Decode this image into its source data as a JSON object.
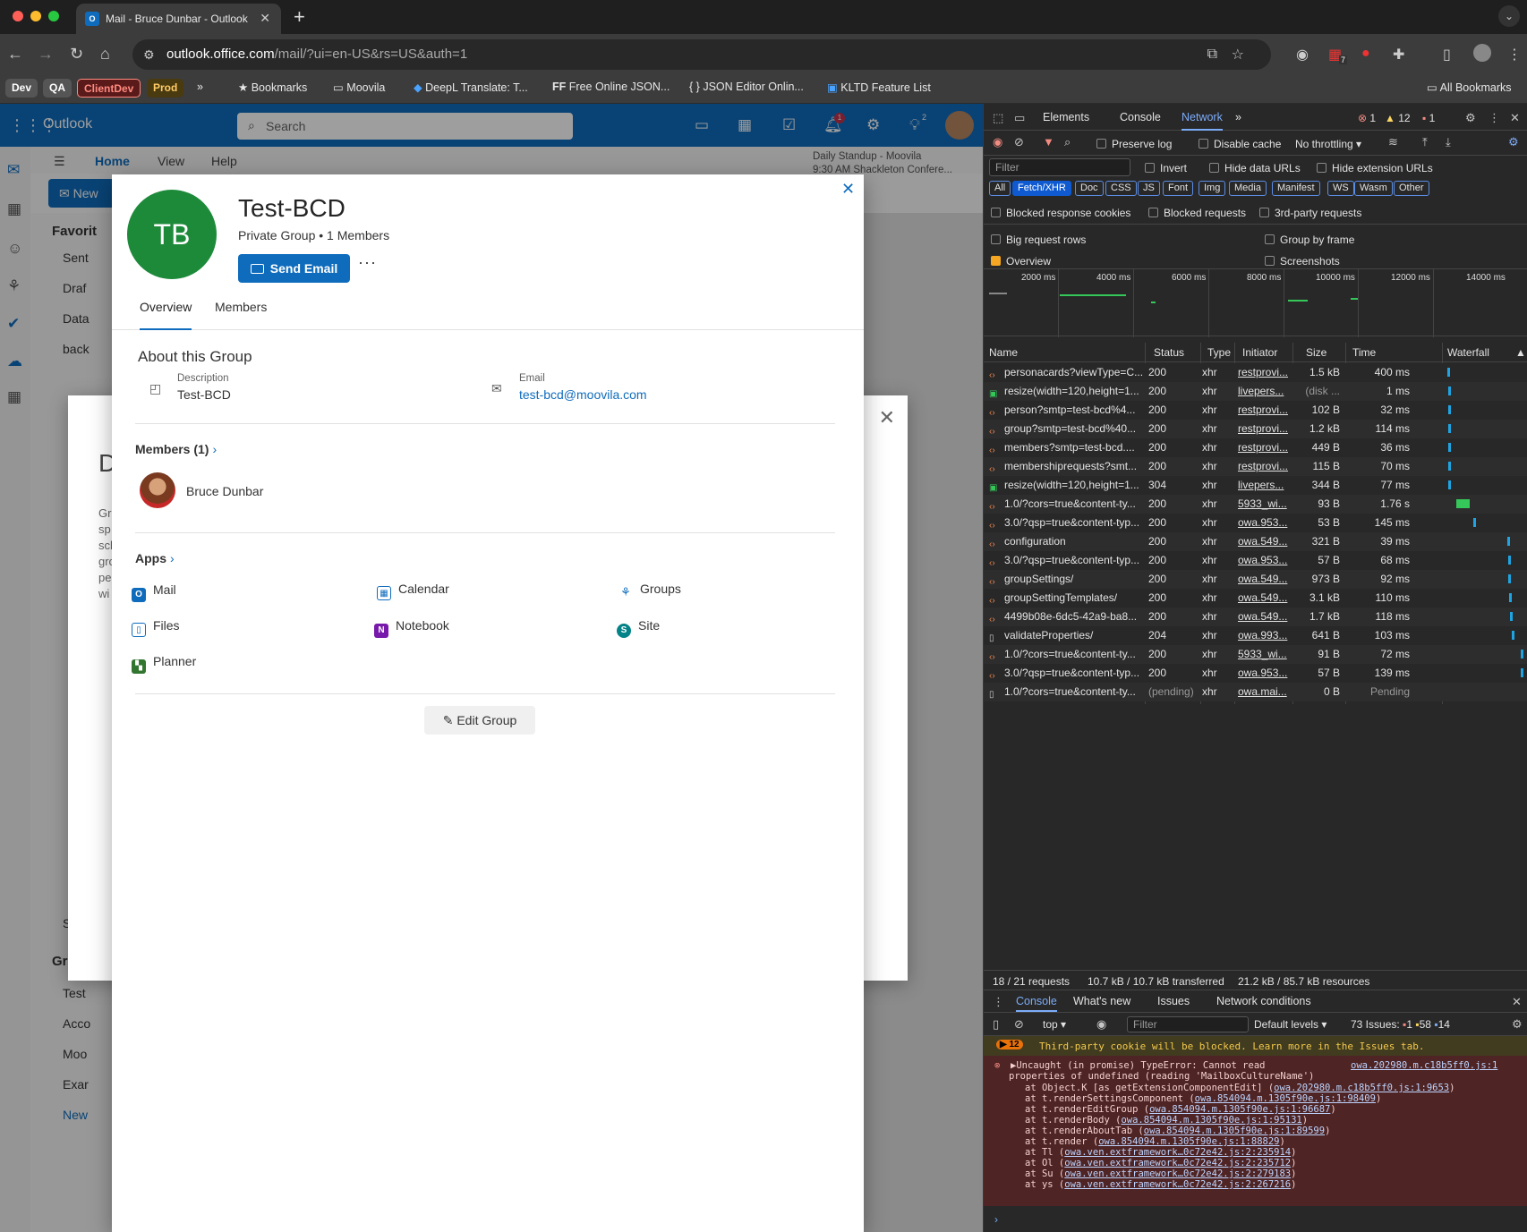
{
  "browser": {
    "tab_title": "Mail - Bruce Dunbar - Outlook",
    "tab_fav": "O",
    "url_host": "outlook.office.com",
    "url_path": "/mail/?ui=en-US&rs=US&auth=1",
    "bookmarks_chips": [
      "Dev",
      "QA",
      "ClientDev",
      "Prod"
    ],
    "bookmarks": [
      "Bookmarks",
      "Moovila",
      "DeepL Translate: T...",
      "Free Online JSON...",
      "JSON Editor Onlin...",
      "KLTD Feature List"
    ],
    "all_bookmarks": "All Bookmarks",
    "more_bookmarks": "»",
    "ext_badge": "7"
  },
  "outlook": {
    "app_name": "Outlook",
    "search_placeholder": "Search",
    "ribbon_tabs": [
      "Home",
      "View",
      "Help"
    ],
    "new_button": "New",
    "meeting_title": "Daily Standup - Moovila",
    "meeting_time": "9:30 AM Shackleton Confere...",
    "folders_header": "Favorit",
    "folders": [
      "Sent",
      "Draf",
      "Data",
      "back"
    ],
    "search_folder": "Sear",
    "groups_header": "Groups",
    "groups": [
      "Test",
      "Acco",
      "Moo",
      "Exar"
    ],
    "new_group": "New",
    "behind_letter": "D",
    "behind_text": [
      "Gr",
      "sp",
      "sch",
      "gro",
      "pe",
      "wi"
    ],
    "notif_badge": "1",
    "tips_badge": "2"
  },
  "card": {
    "initials": "TB",
    "name": "Test-BCD",
    "subtitle": "Private Group • 1 Members",
    "send_email": "Send Email",
    "more": "···",
    "close": "✕",
    "tabs": [
      "Overview",
      "Members"
    ],
    "about_title": "About this Group",
    "description_label": "Description",
    "description_value": "Test-BCD",
    "email_label": "Email",
    "email_value": "test-bcd@moovila.com",
    "members_header": "Members (1)",
    "member_name": "Bruce Dunbar",
    "apps_header": "Apps",
    "apps": [
      "Mail",
      "Calendar",
      "Groups",
      "Files",
      "Notebook",
      "Site",
      "Planner"
    ],
    "edit_group": "Edit Group",
    "colors": {
      "avatar": "#1d8a3a",
      "accent": "#0f6cbd"
    }
  },
  "devtools": {
    "tabs": [
      "Elements",
      "Console",
      "Network"
    ],
    "more_tabs": "»",
    "err_count": "1",
    "warn_count": "12",
    "issue_count": "1",
    "preserve_log": "Preserve log",
    "disable_cache": "Disable cache",
    "throttling": "No throttling",
    "filter_placeholder": "Filter",
    "invert": "Invert",
    "hide_data_urls": "Hide data URLs",
    "hide_ext_urls": "Hide extension URLs",
    "type_filters": [
      "All",
      "Fetch/XHR",
      "Doc",
      "CSS",
      "JS",
      "Font",
      "Img",
      "Media",
      "Manifest",
      "WS",
      "Wasm",
      "Other"
    ],
    "blocked_cookies": "Blocked response cookies",
    "blocked_requests": "Blocked requests",
    "third_party": "3rd-party requests",
    "big_rows": "Big request rows",
    "group_by_frame": "Group by frame",
    "overview": "Overview",
    "screenshots": "Screenshots",
    "overview_ticks": [
      "2000 ms",
      "4000 ms",
      "6000 ms",
      "8000 ms",
      "10000 ms",
      "12000 ms",
      "14000 ms"
    ],
    "columns": [
      "Name",
      "Status",
      "Type",
      "Initiator",
      "Size",
      "Time",
      "Waterfall"
    ],
    "rows": [
      {
        "name": "personacards?viewType=C...",
        "status": "200",
        "type": "xhr",
        "initiator": "restprovi...",
        "size": "1.5 kB",
        "time": "400 ms",
        "wf_start": 0.02,
        "wf_len": 0.04
      },
      {
        "name": "resize(width=120,height=1...",
        "status": "200",
        "type": "xhr",
        "initiator": "livepers...",
        "size": "(disk ...",
        "time": "1 ms",
        "wf_start": 0.03,
        "wf_len": 0.01
      },
      {
        "name": "person?smtp=test-bcd%4...",
        "status": "200",
        "type": "xhr",
        "initiator": "restprovi...",
        "size": "102 B",
        "time": "32 ms",
        "wf_start": 0.03,
        "wf_len": 0.01
      },
      {
        "name": "group?smtp=test-bcd%40...",
        "status": "200",
        "type": "xhr",
        "initiator": "restprovi...",
        "size": "1.2 kB",
        "time": "114 ms",
        "wf_start": 0.03,
        "wf_len": 0.01
      },
      {
        "name": "members?smtp=test-bcd....",
        "status": "200",
        "type": "xhr",
        "initiator": "restprovi...",
        "size": "449 B",
        "time": "36 ms",
        "wf_start": 0.03,
        "wf_len": 0.01
      },
      {
        "name": "membershiprequests?smt...",
        "status": "200",
        "type": "xhr",
        "initiator": "restprovi...",
        "size": "115 B",
        "time": "70 ms",
        "wf_start": 0.03,
        "wf_len": 0.01
      },
      {
        "name": "resize(width=120,height=1...",
        "status": "304",
        "type": "xhr",
        "initiator": "livepers...",
        "size": "344 B",
        "time": "77 ms",
        "wf_start": 0.03,
        "wf_len": 0.01
      },
      {
        "name": "1.0/?cors=true&content-ty...",
        "status": "200",
        "type": "xhr",
        "initiator": "5933_wi...",
        "size": "93 B",
        "time": "1.76 s",
        "wf_start": 0.14,
        "wf_len": 0.17
      },
      {
        "name": "3.0/?qsp=true&content-typ...",
        "status": "200",
        "type": "xhr",
        "initiator": "owa.953...",
        "size": "53 B",
        "time": "145 ms",
        "wf_start": 0.35,
        "wf_len": 0.02
      },
      {
        "name": "configuration",
        "status": "200",
        "type": "xhr",
        "initiator": "owa.549...",
        "size": "321 B",
        "time": "39 ms",
        "wf_start": 0.78,
        "wf_len": 0.01
      },
      {
        "name": "3.0/?qsp=true&content-typ...",
        "status": "200",
        "type": "xhr",
        "initiator": "owa.953...",
        "size": "57 B",
        "time": "68 ms",
        "wf_start": 0.8,
        "wf_len": 0.01
      },
      {
        "name": "groupSettings/",
        "status": "200",
        "type": "xhr",
        "initiator": "owa.549...",
        "size": "973 B",
        "time": "92 ms",
        "wf_start": 0.8,
        "wf_len": 0.01
      },
      {
        "name": "groupSettingTemplates/",
        "status": "200",
        "type": "xhr",
        "initiator": "owa.549...",
        "size": "3.1 kB",
        "time": "110 ms",
        "wf_start": 0.81,
        "wf_len": 0.01
      },
      {
        "name": "4499b08e-6dc5-42a9-ba8...",
        "status": "200",
        "type": "xhr",
        "initiator": "owa.549...",
        "size": "1.7 kB",
        "time": "118 ms",
        "wf_start": 0.82,
        "wf_len": 0.01
      },
      {
        "name": "validateProperties/",
        "status": "204",
        "type": "xhr",
        "initiator": "owa.993...",
        "size": "641 B",
        "time": "103 ms",
        "wf_start": 0.84,
        "wf_len": 0.01
      },
      {
        "name": "1.0/?cors=true&content-ty...",
        "status": "200",
        "type": "xhr",
        "initiator": "5933_wi...",
        "size": "91 B",
        "time": "72 ms",
        "wf_start": 0.95,
        "wf_len": 0.01
      },
      {
        "name": "3.0/?qsp=true&content-typ...",
        "status": "200",
        "type": "xhr",
        "initiator": "owa.953...",
        "size": "57 B",
        "time": "139 ms",
        "wf_start": 0.96,
        "wf_len": 0.01
      },
      {
        "name": "1.0/?cors=true&content-ty...",
        "status": "(pending)",
        "type": "xhr",
        "initiator": "owa.mai...",
        "size": "0 B",
        "time": "Pending",
        "wf_start": 0,
        "wf_len": 0
      }
    ],
    "summary_requests": "18 / 21 requests",
    "summary_transferred": "10.7 kB / 10.7 kB transferred",
    "summary_resources": "21.2 kB / 85.7 kB resources",
    "drawer_tabs": [
      "Console",
      "What's new",
      "Issues",
      "Network conditions"
    ],
    "context": "top ▾",
    "console_filter": "Filter",
    "default_levels": "Default levels ▾",
    "issues_label": "73 Issues:",
    "issues_err": "1",
    "issues_warn": "58",
    "issues_info": "14",
    "warn_badge": "▶ 12",
    "warn_text": "Third-party cookie will be blocked. Learn more in the Issues tab.",
    "error_head": "▶Uncaught (in promise) TypeError: Cannot read",
    "error_src": "owa.202980.m.c18b5ff0.js:1",
    "error_line2": "properties of undefined (reading 'MailboxCultureName')",
    "stack": [
      {
        "fn": "at Object.K [as getExtensionComponentEdit] (",
        "link": "owa.202980.m.c18b5ff0.js:1:9653",
        "end": ")"
      },
      {
        "fn": "at t.renderSettingsComponent (",
        "link": "owa.854094.m.1305f90e.js:1:98409",
        "end": ")"
      },
      {
        "fn": "at t.renderEditGroup (",
        "link": "owa.854094.m.1305f90e.js:1:96687",
        "end": ")"
      },
      {
        "fn": "at t.renderBody (",
        "link": "owa.854094.m.1305f90e.js:1:95131",
        "end": ")"
      },
      {
        "fn": "at t.renderAboutTab (",
        "link": "owa.854094.m.1305f90e.js:1:89599",
        "end": ")"
      },
      {
        "fn": "at t.render (",
        "link": "owa.854094.m.1305f90e.js:1:88829",
        "end": ")"
      },
      {
        "fn": "at Tl (",
        "link": "owa.ven.extframework…0c72e42.js:2:235914",
        "end": ")"
      },
      {
        "fn": "at Ol (",
        "link": "owa.ven.extframework…0c72e42.js:2:235712",
        "end": ")"
      },
      {
        "fn": "at Su (",
        "link": "owa.ven.extframework…0c72e42.js:2:279183",
        "end": ")"
      },
      {
        "fn": "at ys (",
        "link": "owa.ven.extframework…0c72e42.js:2:267216",
        "end": ")"
      }
    ],
    "prompt": "›"
  }
}
